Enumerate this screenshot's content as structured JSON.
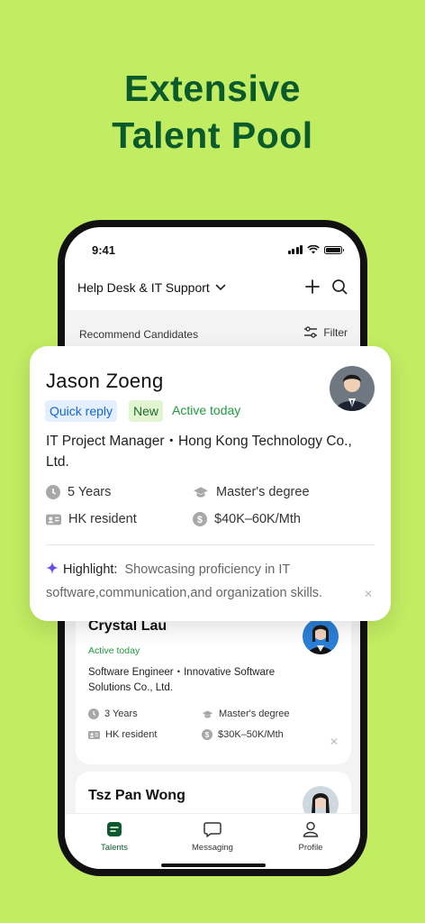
{
  "headline": {
    "line1": "Extensive",
    "line2": "Talent Pool"
  },
  "status_bar": {
    "time": "9:41"
  },
  "navbar": {
    "title": "Help Desk & IT Support"
  },
  "subbar": {
    "title": "Recommend Candidates",
    "filter_label": "Filter"
  },
  "featured": {
    "name": "Jason Zoeng",
    "tags": {
      "quick_reply": "Quick reply",
      "new": "New"
    },
    "activity": "Active today",
    "company": "IT Project Manager・Hong Kong Technology Co., Ltd.",
    "experience": "5 Years",
    "education": "Master's degree",
    "residency": "HK resident",
    "salary": "$40K–60K/Mth",
    "highlight_label": "Highlight:",
    "highlight_text": "Showcasing proficiency in IT software,communication,and organization skills."
  },
  "candidates": [
    {
      "name": "Crystal Lau",
      "activity": "Active today",
      "company": "Software Engineer・Innovative Software Solutions Co., Ltd.",
      "experience": "3 Years",
      "education": "Master's degree",
      "residency": "HK resident",
      "salary": "$30K–50K/Mth"
    },
    {
      "name": "Tsz Pan Wong"
    }
  ],
  "tabbar": {
    "talents": "Talents",
    "messaging": "Messaging",
    "profile": "Profile"
  },
  "colors": {
    "background": "#c2ec62",
    "headline": "#0b5a2c",
    "active_green": "#1f9a3e",
    "quick_reply_blue": "#1565d8",
    "tab_active": "#0b5a2c"
  },
  "icons": [
    "chevron-down-icon",
    "plus-icon",
    "search-icon",
    "filter-icon",
    "clock-icon",
    "graduation-cap-icon",
    "id-card-icon",
    "dollar-icon",
    "sparkle-icon",
    "close-icon",
    "talents-icon",
    "messaging-icon",
    "profile-icon"
  ]
}
